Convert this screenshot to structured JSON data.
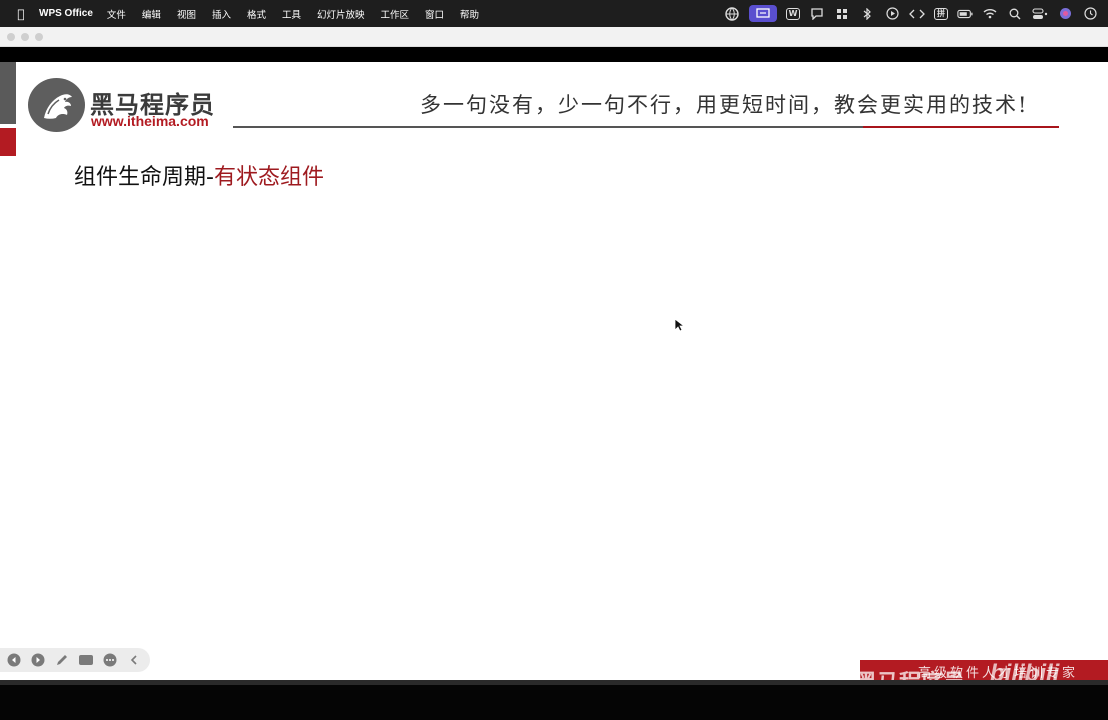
{
  "menubar": {
    "app_name": "WPS Office",
    "items": [
      "文件",
      "编辑",
      "视图",
      "插入",
      "格式",
      "工具",
      "幻灯片放映",
      "工作区",
      "窗口",
      "帮助"
    ],
    "tray": [
      "globe-icon",
      "screen-mirror-icon",
      "wps-w-icon",
      "chat-icon",
      "grid-icon",
      "bluetooth-icon",
      "play-icon",
      "code-icon",
      "input-method-icon",
      "battery-icon",
      "wifi-icon",
      "search-icon",
      "control-center-icon",
      "siri-icon",
      "clock-icon"
    ],
    "input_method_label": "拼",
    "wps_label": "W"
  },
  "slide": {
    "logo_name": "黑马程序员",
    "logo_url": "www.itheima.com",
    "slogan": "多一句没有，少一句不行，用更短时间，教会更实用的技术!",
    "title_main": "组件生命周期-",
    "title_accent": "有状态组件"
  },
  "brand": {
    "slogan": "高级软件人才培训专家",
    "watermark": "黑马程序员",
    "bilibili": "bilibili"
  },
  "controls": [
    "prev-icon",
    "next-icon",
    "pen-icon",
    "screen-icon",
    "more-icon",
    "collapse-icon"
  ],
  "colors": {
    "accent_red": "#b31b22",
    "tray_active": "#5a4fcf"
  }
}
